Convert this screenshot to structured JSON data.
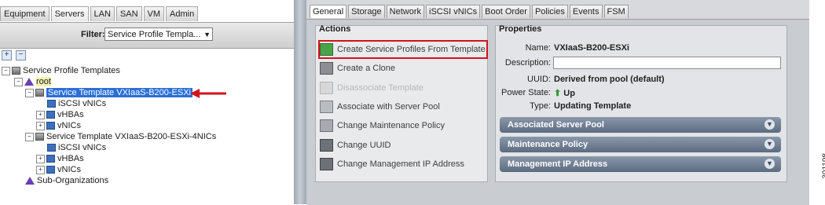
{
  "nav": {
    "tabs": [
      "Equipment",
      "Servers",
      "LAN",
      "SAN",
      "VM",
      "Admin"
    ],
    "active_tab": "Servers",
    "filter_label": "Filter:",
    "filter_value": "Service Profile Templa...",
    "tree": {
      "root_label": "Service Profile Templates",
      "org": "root",
      "template1": "Service Template VXIaaS-B200-ESXi",
      "template1_children": [
        "iSCSI vNICs",
        "vHBAs",
        "vNICs"
      ],
      "template2": "Service Template VXIaaS-B200-ESXi-4NICs",
      "template2_children": [
        "iSCSI vNICs",
        "vHBAs",
        "vNICs"
      ],
      "sub_orgs": "Sub-Organizations"
    }
  },
  "content": {
    "tabs": [
      "General",
      "Storage",
      "Network",
      "iSCSI vNICs",
      "Boot Order",
      "Policies",
      "Events",
      "FSM"
    ],
    "active_tab": "General",
    "actions": {
      "title": "Actions",
      "items": [
        {
          "label": "Create Service Profiles From Template",
          "icon": "create-profiles-icon",
          "enabled": true
        },
        {
          "label": "Create a Clone",
          "icon": "clone-icon",
          "enabled": true
        },
        {
          "label": "Disassociate Template",
          "icon": "disassociate-icon",
          "enabled": false
        },
        {
          "label": "Associate with Server Pool",
          "icon": "server-pool-icon",
          "enabled": true
        },
        {
          "label": "Change Maintenance Policy",
          "icon": "maintenance-icon",
          "enabled": true
        },
        {
          "label": "Change UUID",
          "icon": "uuid-icon",
          "enabled": true
        },
        {
          "label": "Change Management IP Address",
          "icon": "ip-address-icon",
          "enabled": true
        }
      ]
    },
    "properties": {
      "title": "Properties",
      "name_label": "Name:",
      "name_value": "VXIaaS-B200-ESXi",
      "description_label": "Description:",
      "description_value": "",
      "uuid_label": "UUID:",
      "uuid_value": "Derived from pool (default)",
      "power_label": "Power State:",
      "power_value": "Up",
      "type_label": "Type:",
      "type_value": "Updating Template",
      "sections": [
        "Associated Server Pool",
        "Maintenance Policy",
        "Management IP Address"
      ]
    }
  },
  "figure_number": "301198",
  "colors": {
    "highlight": "#d3131b",
    "selection": "#2a6fd6",
    "section_bar": "#6f7d91"
  }
}
